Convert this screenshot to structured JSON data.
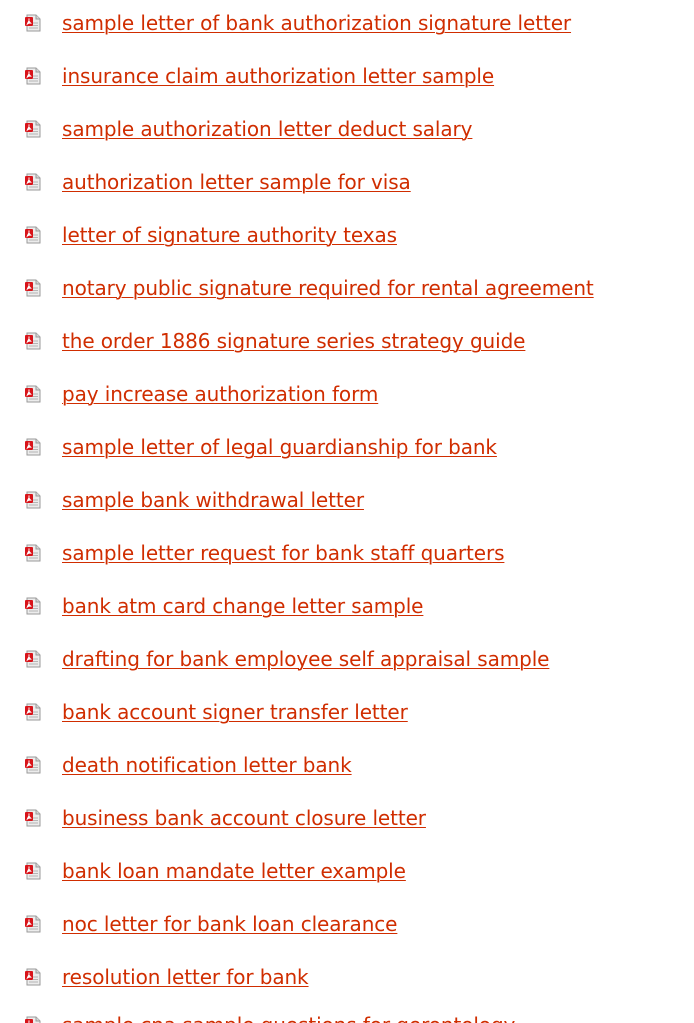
{
  "links": [
    {
      "label": "sample letter of bank authorization signature letter",
      "icon": "pdf-file-icon"
    },
    {
      "label": "insurance claim authorization letter sample",
      "icon": "pdf-file-icon"
    },
    {
      "label": "sample authorization letter deduct salary",
      "icon": "pdf-file-icon"
    },
    {
      "label": "authorization letter sample for visa",
      "icon": "pdf-file-icon"
    },
    {
      "label": "letter of signature authority texas",
      "icon": "pdf-file-icon"
    },
    {
      "label": "notary public signature required for rental agreement",
      "icon": "pdf-file-icon"
    },
    {
      "label": "the order 1886 signature series strategy guide",
      "icon": "pdf-file-icon"
    },
    {
      "label": "pay increase authorization form",
      "icon": "pdf-file-icon"
    },
    {
      "label": "sample letter of legal guardianship for bank",
      "icon": "pdf-file-icon"
    },
    {
      "label": "sample bank withdrawal letter",
      "icon": "pdf-file-icon"
    },
    {
      "label": "sample letter request for bank staff quarters",
      "icon": "pdf-file-icon"
    },
    {
      "label": "bank atm card change letter sample",
      "icon": "pdf-file-icon"
    },
    {
      "label": "drafting for bank employee self appraisal sample",
      "icon": "pdf-file-icon"
    },
    {
      "label": "bank account signer transfer letter",
      "icon": "pdf-file-icon"
    },
    {
      "label": "death notification letter bank",
      "icon": "pdf-file-icon"
    },
    {
      "label": "business bank account closure letter",
      "icon": "pdf-file-icon"
    },
    {
      "label": "bank loan mandate letter example",
      "icon": "pdf-file-icon"
    },
    {
      "label": "noc letter for bank loan clearance",
      "icon": "pdf-file-icon"
    },
    {
      "label": "resolution letter for bank",
      "icon": "pdf-file-icon"
    },
    {
      "label": "sample cna sample questions for gerontology",
      "icon": "pdf-file-icon"
    }
  ],
  "colors": {
    "link": "#d02d00",
    "icon_red": "#d8141a",
    "icon_gray": "#c9c9c9"
  }
}
